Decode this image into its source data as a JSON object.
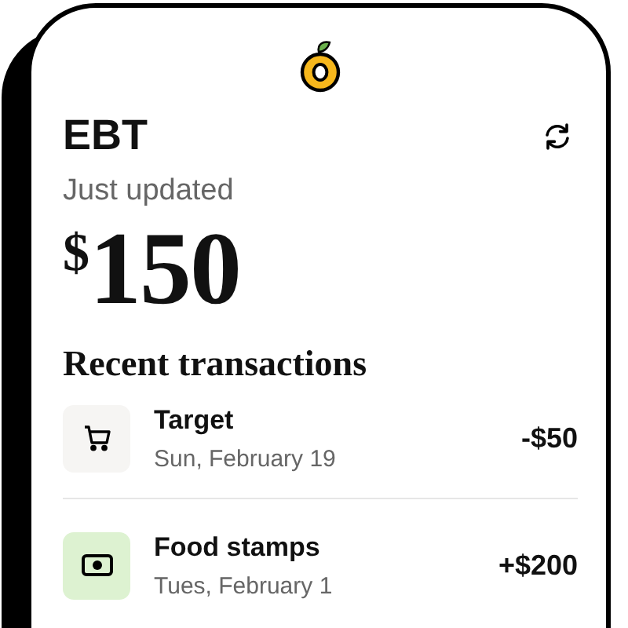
{
  "account": {
    "title": "EBT",
    "status": "Just updated",
    "currency": "$",
    "balance": "150"
  },
  "section_title": "Recent transactions",
  "transactions": [
    {
      "kind": "cart",
      "color": "#f6f5f3",
      "name": "Target",
      "date": "Sun, February 19",
      "amount": "-$50"
    },
    {
      "kind": "cash",
      "color": "#ddf2d1",
      "name": "Food stamps",
      "date": "Tues, February 1",
      "amount": "+$200"
    }
  ]
}
